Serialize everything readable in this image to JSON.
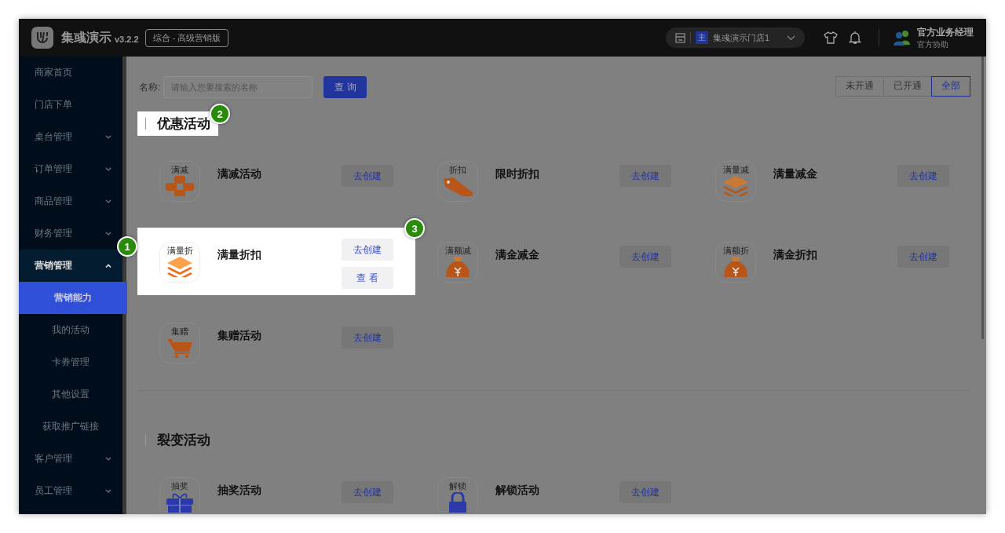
{
  "header": {
    "app_name": "集彧演示",
    "version": "v3.2.2",
    "edition": "综合 - 高级营销版",
    "store": {
      "badge": "主",
      "name": "集彧演示门店1"
    },
    "user": {
      "name": "官方业务经理",
      "role": "官方协助"
    }
  },
  "sidebar": {
    "items": [
      {
        "label": "商家首页",
        "kind": "link",
        "expanded": false
      },
      {
        "label": "门店下单",
        "kind": "link",
        "expanded": false
      },
      {
        "label": "桌台管理",
        "kind": "group",
        "expanded": false
      },
      {
        "label": "订单管理",
        "kind": "group",
        "expanded": false
      },
      {
        "label": "商品管理",
        "kind": "group",
        "expanded": false
      },
      {
        "label": "财务管理",
        "kind": "group",
        "expanded": false
      },
      {
        "label": "营销管理",
        "kind": "group",
        "expanded": true,
        "children": [
          {
            "label": "营销能力",
            "selected": true
          },
          {
            "label": "我的活动",
            "selected": false
          },
          {
            "label": "卡券管理",
            "selected": false
          },
          {
            "label": "其他设置",
            "selected": false
          },
          {
            "label": "获取推广链接",
            "selected": false
          }
        ]
      },
      {
        "label": "客户管理",
        "kind": "group",
        "expanded": false
      },
      {
        "label": "员工管理",
        "kind": "group",
        "expanded": false
      }
    ]
  },
  "search": {
    "label": "名称:",
    "placeholder": "请输入您要搜索的名称",
    "button": "查 询"
  },
  "filter_tabs": [
    {
      "label": "未开通",
      "selected": false
    },
    {
      "label": "已开通",
      "selected": false
    },
    {
      "label": "全部",
      "selected": true
    }
  ],
  "sections": [
    {
      "title": "优惠活动",
      "highlighted": true,
      "guide_mark": "2",
      "items": [
        {
          "icon_label": "满减",
          "kind": "dots",
          "name": "满减活动",
          "actions": [
            "去创建"
          ],
          "highlighted": false
        },
        {
          "icon_label": "折扣",
          "kind": "tag",
          "name": "限时折扣",
          "actions": [
            "去创建"
          ],
          "highlighted": false
        },
        {
          "icon_label": "满量减",
          "kind": "layers",
          "name": "满量减金",
          "actions": [
            "去创建"
          ],
          "highlighted": false
        },
        {
          "icon_label": "满量折",
          "kind": "layers",
          "name": "满量折扣",
          "actions": [
            "去创建",
            "查 看"
          ],
          "highlighted": true,
          "guide_marks": [
            "1",
            "3"
          ]
        },
        {
          "icon_label": "满额减",
          "kind": "moneybag",
          "name": "满金减金",
          "actions": [
            "去创建"
          ],
          "highlighted": false
        },
        {
          "icon_label": "满额折",
          "kind": "moneybag",
          "name": "满金折扣",
          "actions": [
            "去创建"
          ],
          "highlighted": false
        },
        {
          "icon_label": "集赠",
          "kind": "cart",
          "name": "集赠活动",
          "actions": [
            "去创建"
          ],
          "highlighted": false
        }
      ]
    },
    {
      "title": "裂变活动",
      "highlighted": false,
      "items": [
        {
          "icon_label": "抽奖",
          "kind": "gift",
          "name": "抽奖活动",
          "actions": [
            "去创建"
          ],
          "highlighted": false
        },
        {
          "icon_label": "解锁",
          "kind": "lock",
          "name": "解锁活动",
          "actions": [
            "去创建"
          ],
          "highlighted": false
        }
      ]
    }
  ]
}
